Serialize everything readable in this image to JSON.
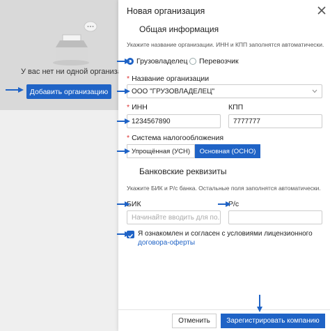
{
  "background": {
    "empty_text": "У вас нет ни одной организации",
    "add_org_button": "Добавить организацию"
  },
  "drawer": {
    "title": "Новая организация",
    "general": {
      "title": "Общая информация",
      "hint": "Укажите название организации. ИНН и КПП заполнятся автоматически."
    },
    "role_options": [
      {
        "label": "Грузовладелец",
        "selected": true
      },
      {
        "label": "Перевозчик",
        "selected": false
      }
    ],
    "org_name": {
      "label": "Название организации",
      "value": "ООО \"ГРУЗОВЛАДЕЛЕЦ\""
    },
    "inn": {
      "label": "ИНН",
      "value": "1234567890"
    },
    "kpp": {
      "label": "КПП",
      "value": "7777777"
    },
    "tax": {
      "label": "Система налогообложения",
      "options": [
        {
          "label": "Упрощённая (УСН)",
          "selected": false
        },
        {
          "label": "Основная (ОСНО)",
          "selected": true
        }
      ]
    },
    "bank": {
      "title": "Банковские реквизиты",
      "hint": "Укажите БИК и Р/с банка. Остальные поля заполнятся автоматически.",
      "bik_label": "БИК",
      "bik_placeholder": "Начинайте вводить для по...",
      "account_label": "Р/с",
      "account_value": ""
    },
    "consent": {
      "text": "Я ознакомлен и согласен с условиями лицензионного",
      "link": "договора-оферты",
      "checked": true
    },
    "cancel_button": "Отменить",
    "register_button": "Зарегистрировать компанию"
  },
  "colors": {
    "accent": "#1f63c6",
    "required": "#dd3333",
    "annotation_arrow": "#1f63c6"
  },
  "icons": [
    "close-icon",
    "chevron-down-icon",
    "empty-inbox-icon",
    "checkbox-check-icon"
  ]
}
